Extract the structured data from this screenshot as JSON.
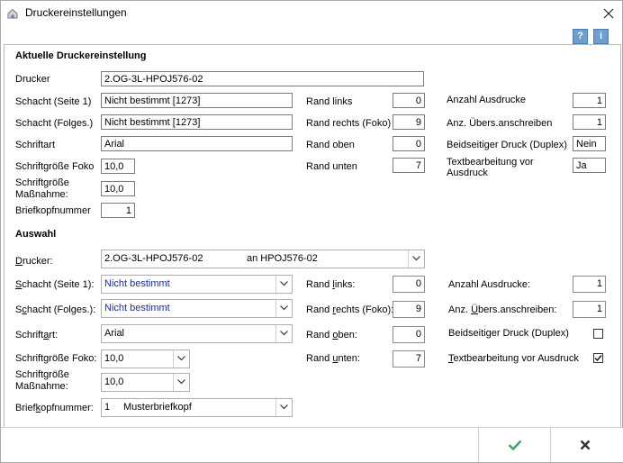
{
  "window": {
    "title": "Druckereinstellungen"
  },
  "icons": {
    "help": "?",
    "info": "i"
  },
  "aktuell": {
    "title": "Aktuelle Druckereinstellung",
    "drucker_label": "Drucker",
    "drucker_value": "2.OG-3L-HPOJ576-02",
    "schacht1_label": "Schacht (Seite 1)",
    "schacht1_value": "Nicht bestimmt [1273]",
    "schachtf_label": "Schacht (Folges.)",
    "schachtf_value": "Nicht bestimmt [1273]",
    "schriftart_label": "Schriftart",
    "schriftart_value": "Arial",
    "sgfoko_label": "Schriftgröße Foko",
    "sgfoko_value": "10,0",
    "sgmass_label1": "Schriftgröße",
    "sgmass_label2": "Maßnahme:",
    "sgmass_value": "10,0",
    "briefkopf_label": "Briefkopfnummer",
    "briefkopf_value": "1",
    "randlinks_label": "Rand links",
    "randlinks_value": "0",
    "randrechts_label": "Rand rechts (Foko)",
    "randrechts_value": "9",
    "randoben_label": "Rand oben",
    "randoben_value": "0",
    "randunten_label": "Rand unten",
    "randunten_value": "7",
    "anzahl_label": "Anzahl Ausdrucke",
    "anzahl_value": "1",
    "uebers_label": "Anz. Übers.anschreiben",
    "uebers_value": "1",
    "duplex_label": "Beidseitiger Druck (Duplex)",
    "duplex_value": "Nein",
    "textbearb_label1": "Textbearbeitung vor",
    "textbearb_label2": "Ausdruck",
    "textbearb_value": "Ja"
  },
  "auswahl": {
    "title": "Auswahl",
    "drucker_label_pre": "",
    "drucker_label_u": "D",
    "drucker_label_post": "rucker:",
    "drucker_value": "2.OG-3L-HPOJ576-02",
    "drucker_value2": "an HPOJ576-02",
    "schacht1_label_u": "S",
    "schacht1_label_post": "chacht (Seite 1):",
    "schacht1_value": "Nicht bestimmt",
    "schachtf_label_pre": "S",
    "schachtf_label_u": "c",
    "schachtf_label_post": "hacht (Folges.):",
    "schachtf_value": "Nicht bestimmt",
    "schriftart_label_pre": "Schrift",
    "schriftart_label_u": "a",
    "schriftart_label_post": "rt:",
    "schriftart_value": "Arial",
    "sgfoko_label": "Schriftgröße Foko:",
    "sgfoko_value": "10,0",
    "sgmass_label1": "Schriftgröße",
    "sgmass_label2": "Maßnahme:",
    "sgmass_value": "10,0",
    "briefkopf_label_pre": "Brief",
    "briefkopf_label_u": "k",
    "briefkopf_label_post": "opfnummer:",
    "briefkopf_value": "1",
    "briefkopf_value2": "Musterbriefkopf",
    "randlinks_label_pre": "Rand ",
    "randlinks_label_u": "l",
    "randlinks_label_post": "inks:",
    "randlinks_value": "0",
    "randrechts_label_pre": "Rand ",
    "randrechts_label_u": "r",
    "randrechts_label_post": "echts (Foko):",
    "randrechts_value": "9",
    "randoben_label_pre": "Rand ",
    "randoben_label_u": "o",
    "randoben_label_post": "ben:",
    "randoben_value": "0",
    "randunten_label_pre": "Rand ",
    "randunten_label_u": "u",
    "randunten_label_post": "nten:",
    "randunten_value": "7",
    "anzahl_label": "Anzahl Ausdrucke:",
    "anzahl_value": "1",
    "uebers_label_pre": "Anz. ",
    "uebers_label_u": "Ü",
    "uebers_label_post": "bers.anschreiben:",
    "uebers_value": "1",
    "duplex_label": "Beidseitiger Druck (Duplex)",
    "duplex_checked": false,
    "textbearb_label_u": "T",
    "textbearb_label_post": "extbearbeitung vor Ausdruck",
    "textbearb_checked": true
  },
  "footer": {
    "ok_icon": "checkmark-icon",
    "cancel_icon": "x-icon"
  },
  "colors": {
    "accent_check": "#3aa35e",
    "link_blue": "#1a2d9a",
    "help_icon": "#6a9fd0"
  }
}
